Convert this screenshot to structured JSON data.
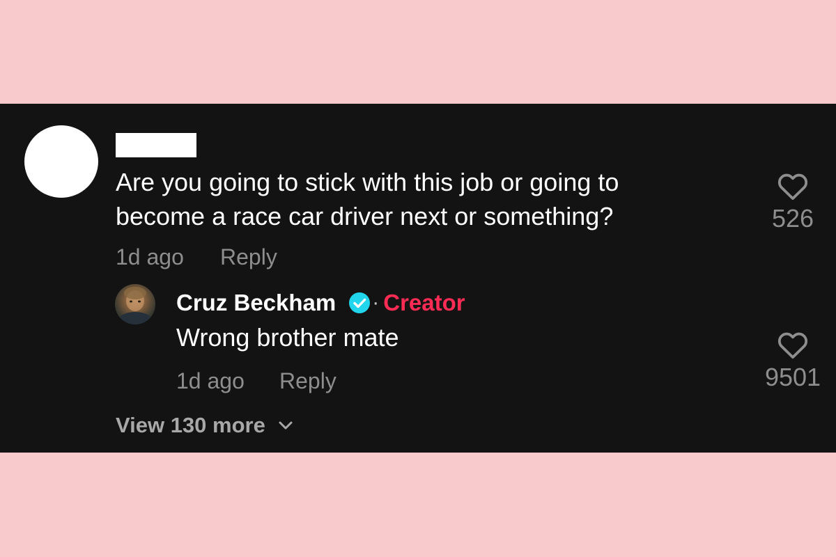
{
  "comments": [
    {
      "text": "Are you going to stick with this job or going to become a race car driver next or something?",
      "time": "1d ago",
      "reply_label": "Reply",
      "likes": "526"
    }
  ],
  "reply": {
    "author": "Cruz Beckham",
    "badge": "Creator",
    "separator": "·",
    "text": "Wrong brother mate",
    "time": "1d ago",
    "reply_label": "Reply",
    "likes": "9501"
  },
  "view_more_label": "View 130 more",
  "colors": {
    "background": "#f9cacc",
    "panel": "#131313",
    "creator": "#fe2c55",
    "verified": "#20d5ec",
    "meta_text": "#8e8e8e"
  },
  "icons": {
    "like": "heart-outline-icon",
    "verified": "verified-check-icon",
    "expand": "chevron-down-icon"
  }
}
